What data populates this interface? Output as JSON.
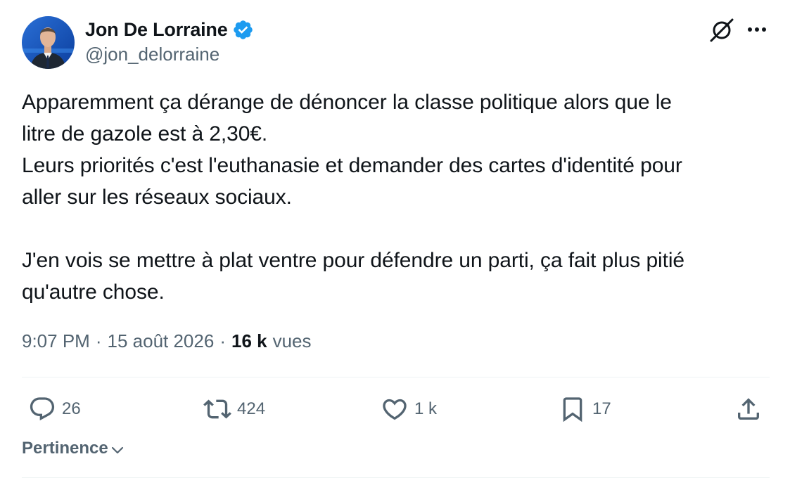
{
  "author": {
    "name": "Jon De Lorraine",
    "handle": "@jon_delorraine",
    "verified": true,
    "verified_color": "#1d9bf0"
  },
  "tweet": {
    "text": "Apparemment ça dérange de dénoncer la classe politique alors que le\nlitre de gazole est à 2,30€.\nLeurs priorités c'est l'euthanasie et demander des cartes d'identité pour\naller sur les réseaux sociaux.\n\nJ'en vois se mettre à plat ventre pour défendre un parti, ça fait plus pitié\nqu'autre chose."
  },
  "meta": {
    "time": "9:07 PM",
    "separator": "·",
    "date": "15 août 2026",
    "views_count": "16 k",
    "views_label": "vues"
  },
  "actions": {
    "reply": {
      "icon": "reply-icon",
      "count": "26"
    },
    "retweet": {
      "icon": "retweet-icon",
      "count": "424"
    },
    "like": {
      "icon": "like-icon",
      "count": "1 k"
    },
    "bookmark": {
      "icon": "bookmark-icon",
      "count": "17"
    },
    "share": {
      "icon": "share-icon"
    }
  },
  "header_icons": {
    "grok": "grok-icon",
    "more": "more-icon"
  },
  "sort": {
    "label": "Pertinence",
    "icon": "chevron-down-icon"
  },
  "colors": {
    "text_primary": "#0f1419",
    "text_secondary": "#536471",
    "accent": "#1d9bf0",
    "divider": "#eff3f4"
  }
}
